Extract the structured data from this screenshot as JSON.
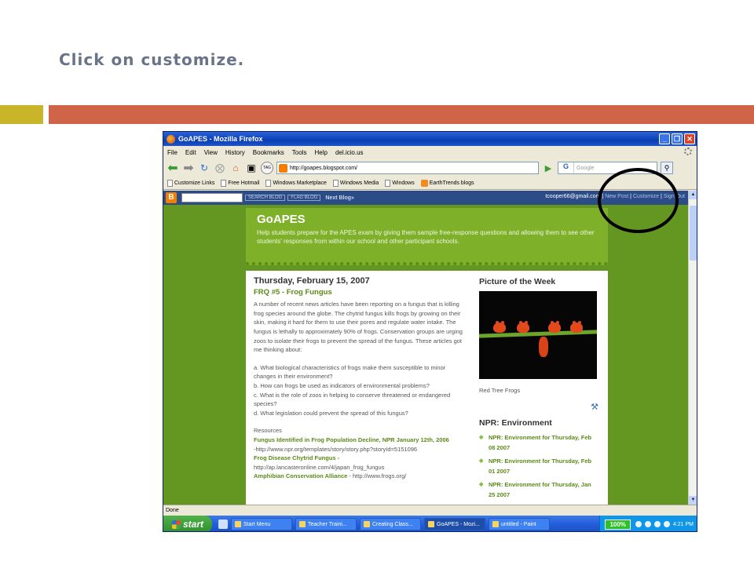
{
  "slide": {
    "title": "Click on customize."
  },
  "browser": {
    "window_title": "GoAPES - Mozilla Firefox",
    "window_buttons": [
      "_",
      "❐",
      "✕"
    ],
    "menu": [
      "File",
      "Edit",
      "View",
      "History",
      "Bookmarks",
      "Tools",
      "Help",
      "del.icio.us"
    ],
    "tag_label": "TAG",
    "url": "http://goapes.blogspot.com/",
    "search_placeholder": "Google",
    "search_engine_letter": "G",
    "bookmarks": [
      "Customize Links",
      "Free Hotmail",
      "Windows Marketplace",
      "Windows Media",
      "Windows",
      "EarthTrends blogs"
    ],
    "status": "Done"
  },
  "blogger_nav": {
    "search_blog": "SEARCH BLOG",
    "flag_blog": "FLAG BLOG",
    "next_blog": "Next Blog»",
    "email": "tcooper66@gmail.com",
    "new_post": "New Post",
    "customize": "Customize",
    "sign_out": "Sign Out",
    "separator": "|"
  },
  "blog": {
    "name": "GoAPES",
    "description": "Help students prepare for the APES exam by giving them sample free-response questions and allowing them to see other students' responses from within our school and other participant schools."
  },
  "post": {
    "date": "Thursday, February 15, 2007",
    "title": "FRQ #5 - Frog Fungus",
    "paragraph1": "A number of recent news articles have been reporting on a fungus that is killing frog species around the globe. The chytrid fungus kills frogs by growing on their skin, making it hard for them to use their pores and regulate water intake. The fungus is lethally to approximately 90% of frogs. Conservation groups are urging zoos to isolate their frogs to prevent the spread of the fungus. These articles got me thinking about:",
    "question_a": "a. What biological characteristics of frogs make them susceptible to minor changes in their environment?",
    "question_b": "b. How can frogs be used as indicators of environmental problems?",
    "question_c": "c. What is the role of zoos in helping to conserve threatened or endangered species?",
    "question_d": "d. What legislation could prevent the spread of this fungus?",
    "resources_label": "Resources",
    "link1": "Fungus Identified in Frog Population Decline, NPR January 12th, 2006",
    "link1_url": "-http://www.npr.org/templates/story/story.php?storyId=5151096",
    "link2": "Frog Disease Chytrid Fungus -",
    "link2_url": "http://ap.lancasteronline.com/4/japan_frog_fungus",
    "link3": "Amphibian Conservation Alliance",
    "link3_url": " - http://www.frogs.org/"
  },
  "sidebar": {
    "picture_title": "Picture of the Week",
    "photo_caption": "Red Tree Frogs",
    "npr_title": "NPR: Environment",
    "npr_items": [
      "NPR: Environment for Thursday, Feb 08 2007",
      "NPR: Environment for Thursday, Feb 01 2007",
      "NPR: Environment for Thursday, Jan 25 2007"
    ]
  },
  "taskbar": {
    "start": "start",
    "tasks": [
      "Start Menu",
      "Teacher Traini...",
      "Creating Class...",
      "GoAPES - Mozi...",
      "untitled - Paint"
    ],
    "zoom": "100%",
    "clock": "4:21 PM"
  },
  "colors": {
    "title_text": "#6a7489",
    "accent_yellow": "#c9b52a",
    "accent_orange": "#cf6448",
    "blog_green": "#639721",
    "header_green": "#7fb029"
  }
}
